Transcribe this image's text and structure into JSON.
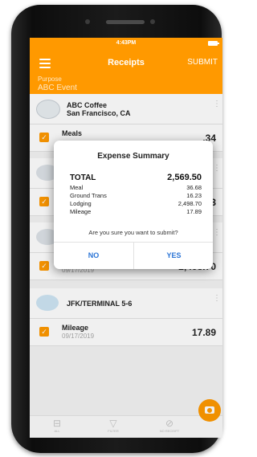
{
  "status": {
    "time": "4:43PM"
  },
  "appbar": {
    "title": "Receipts",
    "submit_label": "SUBMIT"
  },
  "purpose": {
    "label": "Purpose",
    "value": "ABC Event"
  },
  "groups": [
    {
      "merchant_line1": "ABC Coffee",
      "merchant_line2": "San Francisco, CA",
      "expense": {
        "type": "Meals",
        "date": "",
        "amount": ".34"
      }
    },
    {
      "merchant_line1": "",
      "merchant_line2": "",
      "expense": {
        "type": "",
        "date": "",
        "amount": ".23"
      }
    },
    {
      "merchant_line1": "",
      "merchant_line2": "",
      "expense": {
        "type": "",
        "date": "09/17/2019",
        "amount": "2,498.70"
      }
    },
    {
      "merchant_line1": "JFK/TERMINAL 5-6",
      "merchant_line2": "",
      "expense": {
        "type": "Mileage",
        "date": "09/17/2019",
        "amount": "17.89"
      }
    }
  ],
  "dialog": {
    "title": "Expense Summary",
    "total_label": "TOTAL",
    "total_value": "2,569.50",
    "lines": [
      {
        "label": "Meal",
        "value": "36.68"
      },
      {
        "label": "Ground Trans",
        "value": "16.23"
      },
      {
        "label": "Lodging",
        "value": "2,498.70"
      },
      {
        "label": "Mileage",
        "value": "17.89"
      }
    ],
    "question": "Are you sure you want to submit?",
    "no_label": "NO",
    "yes_label": "YES"
  },
  "tabbar": {
    "tabs": [
      "ALL",
      "FILTER",
      "NO RECEIPT"
    ]
  },
  "icons": {
    "menu": "hamburger-icon",
    "camera": "camera-icon",
    "checkbox": "checkmark-icon"
  },
  "colors": {
    "accent": "#ff9900",
    "dialog_button": "#2a74d6"
  }
}
